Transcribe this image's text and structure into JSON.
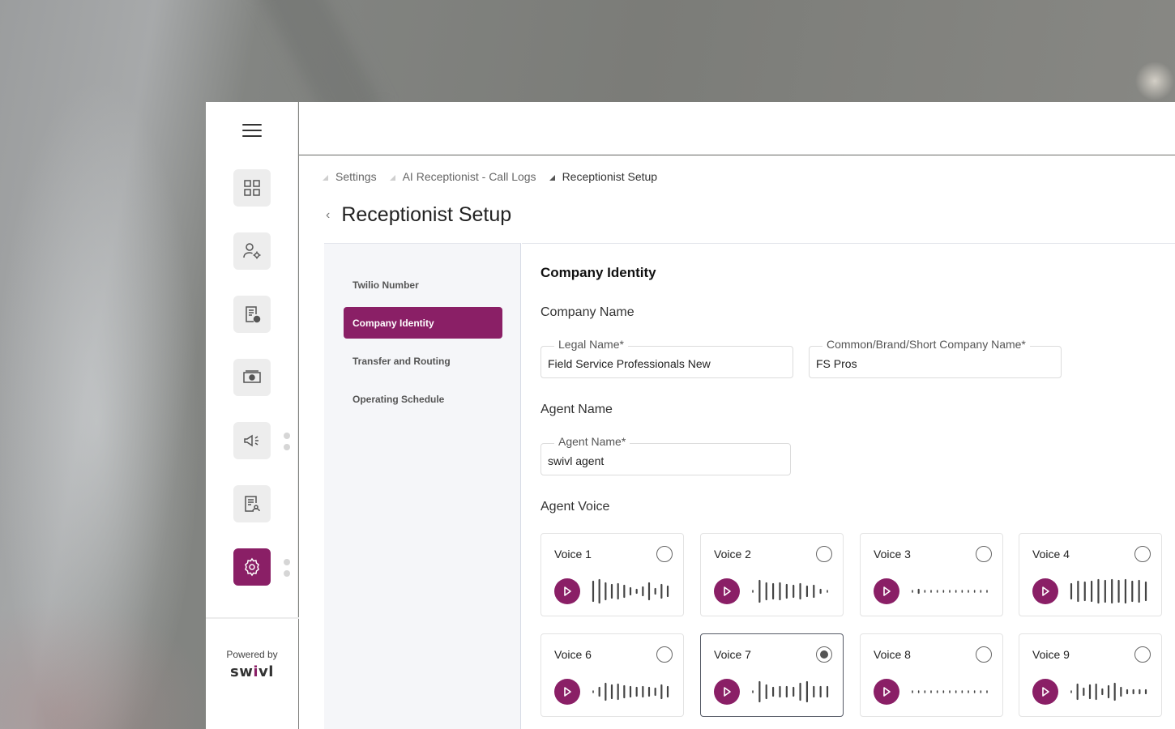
{
  "sidebar": {
    "menu_icon": "hamburger-icon",
    "items": [
      {
        "name": "dashboard",
        "icon": "grid-icon"
      },
      {
        "name": "user-settings",
        "icon": "user-gear-icon"
      },
      {
        "name": "logs",
        "icon": "document-clock-icon"
      },
      {
        "name": "billing",
        "icon": "money-icon"
      },
      {
        "name": "campaigns",
        "icon": "megaphone-icon"
      },
      {
        "name": "reports",
        "icon": "report-icon"
      },
      {
        "name": "settings",
        "icon": "gear-icon",
        "active": true
      }
    ],
    "powered_by": "Powered by",
    "brand": "swivl"
  },
  "breadcrumb": [
    "Settings",
    "AI Receptionist - Call Logs",
    "Receptionist Setup"
  ],
  "page": {
    "title": "Receptionist Setup"
  },
  "setup_nav": [
    {
      "label": "Twilio Number",
      "active": false
    },
    {
      "label": "Company Identity",
      "active": true
    },
    {
      "label": "Transfer and Routing",
      "active": false
    },
    {
      "label": "Operating Schedule",
      "active": false
    }
  ],
  "identity": {
    "section_title": "Company Identity",
    "company_name_heading": "Company Name",
    "legal_name": {
      "label": "Legal Name*",
      "value": "Field Service Professionals New"
    },
    "short_name": {
      "label": "Common/Brand/Short Company Name*",
      "value": "FS Pros"
    },
    "agent_name_heading": "Agent Name",
    "agent_name": {
      "label": "Agent Name*",
      "value": "swivl agent"
    },
    "agent_voice_heading": "Agent Voice"
  },
  "voices": [
    {
      "label": "Voice 1",
      "selected": false,
      "wave": [
        24,
        28,
        20,
        16,
        18,
        14,
        8,
        4,
        10,
        20,
        6,
        16,
        12
      ]
    },
    {
      "label": "Voice 2",
      "selected": false,
      "wave": [
        2,
        26,
        20,
        18,
        20,
        16,
        14,
        18,
        12,
        14,
        4,
        2
      ]
    },
    {
      "label": "Voice 3",
      "selected": false,
      "wave": [
        2,
        4,
        2,
        2,
        2,
        2,
        2,
        2,
        2,
        2,
        2,
        2,
        2
      ]
    },
    {
      "label": "Voice 4",
      "selected": false,
      "wave": [
        18,
        24,
        22,
        24,
        28,
        26,
        28,
        26,
        28,
        24,
        26,
        22
      ]
    },
    {
      "label": "Voice 6",
      "selected": false,
      "wave": [
        2,
        10,
        20,
        16,
        18,
        14,
        12,
        10,
        12,
        10,
        8,
        16,
        12
      ]
    },
    {
      "label": "Voice 7",
      "selected": true,
      "wave": [
        2,
        24,
        16,
        10,
        12,
        12,
        10,
        20,
        24,
        12,
        12,
        12
      ]
    },
    {
      "label": "Voice 8",
      "selected": false,
      "wave": [
        2,
        2,
        2,
        2,
        2,
        2,
        2,
        2,
        2,
        2,
        2,
        2,
        2
      ]
    },
    {
      "label": "Voice 9",
      "selected": false,
      "wave": [
        2,
        18,
        8,
        16,
        18,
        6,
        14,
        20,
        10,
        4,
        4,
        4,
        4
      ]
    }
  ],
  "colors": {
    "accent": "#8a1f66"
  }
}
